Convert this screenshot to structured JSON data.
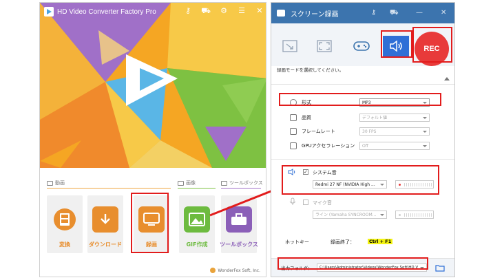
{
  "left_app": {
    "title": "HD Video Converter Factory Pro",
    "sections": [
      {
        "label": "動画",
        "icon": "film-icon"
      },
      {
        "label": "画像",
        "icon": "image-icon"
      },
      {
        "label": "ツールボックス",
        "icon": "toolbox-icon"
      }
    ],
    "tiles": [
      {
        "label": "変換",
        "icon": "convert-film-icon",
        "color": "#e88e2e"
      },
      {
        "label": "ダウンロード",
        "icon": "download-icon",
        "color": "#e88e2e"
      },
      {
        "label": "録画",
        "icon": "screen-record-icon",
        "color": "#e88e2e"
      },
      {
        "label": "GIF作成",
        "icon": "gif-maker-icon",
        "color": "#6dbb3f"
      },
      {
        "label": "ツールボックス",
        "icon": "toolbox-icon",
        "color": "#8b5fb8"
      }
    ],
    "footer": "WonderFox Soft, Inc.",
    "colors": {
      "orange": "#f5a623",
      "green": "#7ec142",
      "purple": "#a070c8",
      "blue": "#5ab6e6",
      "yellow": "#f7c948"
    }
  },
  "recorder": {
    "title": "スクリーン録画",
    "mode_buttons": [
      {
        "name": "region-mode",
        "icon": "region-select-icon"
      },
      {
        "name": "fullscreen-mode",
        "icon": "fullscreen-icon"
      },
      {
        "name": "game-mode",
        "icon": "gamepad-icon"
      },
      {
        "name": "audio-mode",
        "icon": "speaker-icon",
        "selected": true
      }
    ],
    "rec_label": "REC",
    "hint": "録画モードを選択してください。",
    "settings": [
      {
        "label": "形式",
        "value": "MP3",
        "icon": "gear-icon",
        "enabled": true
      },
      {
        "label": "品質",
        "value": "デフォルト値",
        "icon": "quality-icon",
        "enabled": false
      },
      {
        "label": "フレームレート",
        "value": "30 FPS",
        "icon": "framerate-icon",
        "enabled": false
      },
      {
        "label": "GPUアクセラレーション",
        "value": "Off",
        "icon": "gpu-icon",
        "enabled": false
      }
    ],
    "system_audio": {
      "label": "システム音",
      "checked": "✓",
      "device": "Redmi 27 NF (NVIDIA High ..."
    },
    "mic": {
      "label": "マイク音",
      "device": "ライン (Yamaha SYNCROOM..."
    },
    "hotkey": {
      "label": "ホットキー",
      "action": "録画終了：",
      "value": "Ctrl + F1"
    },
    "output": {
      "label": "出力フォルダ：",
      "path": "C:\\Users\\Administrator\\Videos\\WonderFox Soft\\HD V"
    }
  }
}
